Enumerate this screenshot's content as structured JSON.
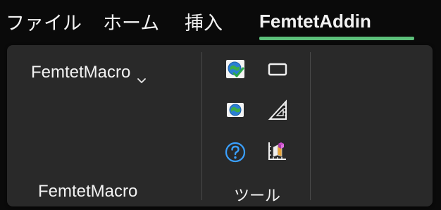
{
  "tabs": {
    "file": "ファイル",
    "home": "ホーム",
    "insert": "挿入",
    "active": "FemtetAddin"
  },
  "ribbon": {
    "macro_group": {
      "dropdown_label": "FemtetMacro",
      "group_label": "FemtetMacro"
    },
    "tools_group": {
      "group_label": "ツール",
      "icons": [
        "globe-check-icon",
        "window-frame-icon",
        "globe-icon",
        "triangle-ruler-icon",
        "help-icon",
        "cube-ruler-icon"
      ]
    }
  },
  "colors": {
    "accent_underline": "#5cbf7a",
    "ribbon_bg": "#292929",
    "background": "#0a0a0a",
    "help_blue": "#3aa0ff"
  }
}
